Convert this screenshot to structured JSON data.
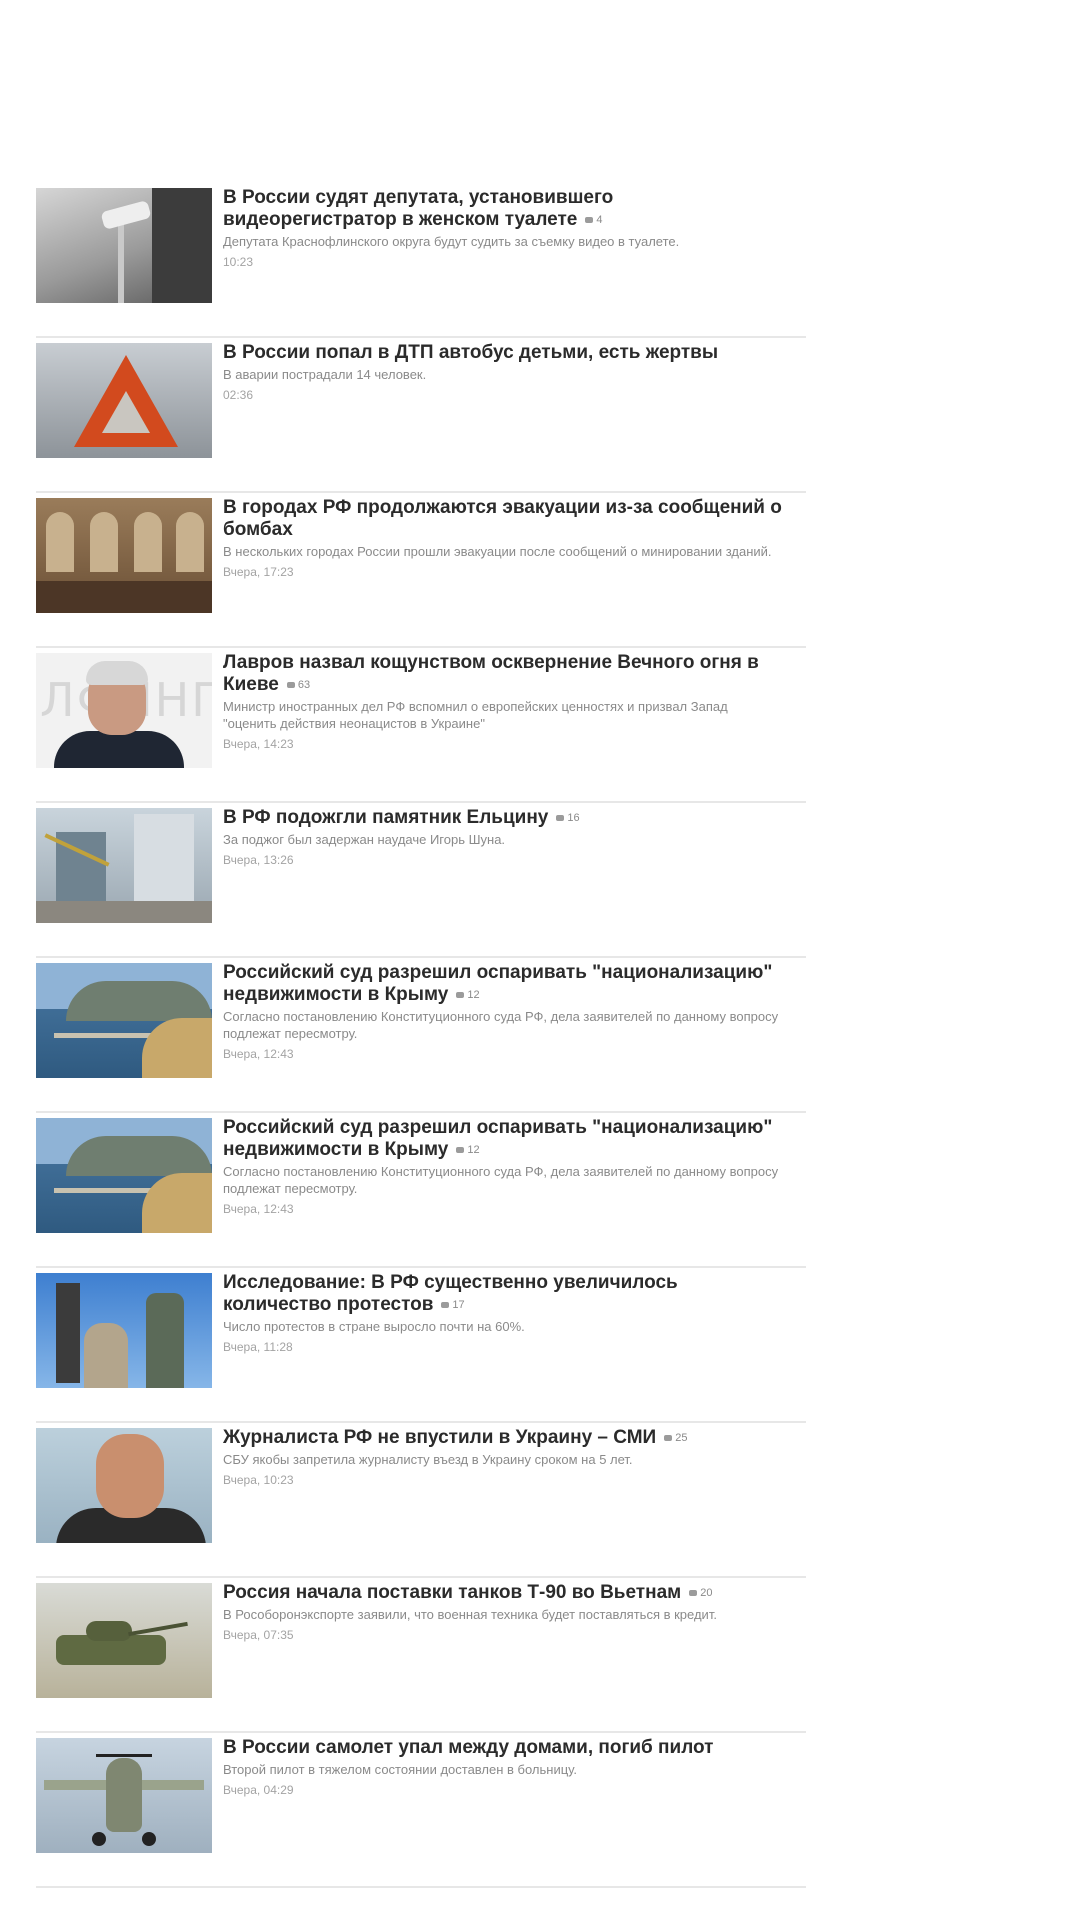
{
  "news": [
    {
      "title": "В России судят депутата, установившего видеорегистратор в женском туалете",
      "comments": "4",
      "desc": "Депутата Краснофлинского округа будут судить за съемку видео в туалете.",
      "time": "10:23",
      "image": "camera-thumbnail"
    },
    {
      "title": "В России попал в ДТП автобус детьми, есть жертвы",
      "comments": "",
      "desc": "В аварии пострадали 14 человек.",
      "time": "02:36",
      "image": "warning-triangle-thumbnail"
    },
    {
      "title": "В городах РФ продолжаются эвакуации из-за сообщений о бомбах",
      "comments": "",
      "desc": "В нескольких городах России прошли эвакуации после сообщений о минировании зданий.",
      "time": "Вчера, 17:23",
      "image": "evacuation-thumbnail"
    },
    {
      "title": "Лавров назвал кощунством осквернение Вечного огня в Киеве",
      "comments": "63",
      "desc": "Министр иностранных дел РФ вспомнил о европейских ценностях и призвал Запад \"оценить действия неонацистов в Украине\"",
      "time": "Вчера, 14:23",
      "image": "minister-portrait-thumbnail"
    },
    {
      "title": "В РФ подожгли памятник Ельцину",
      "comments": "16",
      "desc": "За поджог был задержан наудаче Игорь Шуна.",
      "time": "Вчера, 13:26",
      "image": "monument-thumbnail"
    },
    {
      "title": "Российский суд разрешил оспаривать \"национализацию\" недвижимости в Крыму",
      "comments": "12",
      "desc": "Согласно постановлению Конституционного суда РФ, дела заявителей по данному вопросу подлежат пересмотру.",
      "time": "Вчера, 12:43",
      "image": "crimea-coast-thumbnail"
    },
    {
      "title": "Российский суд разрешил оспаривать \"национализацию\" недвижимости в Крыму",
      "comments": "12",
      "desc": "Согласно постановлению Конституционного суда РФ, дела заявителей по данному вопросу подлежат пересмотру.",
      "time": "Вчера, 12:43",
      "image": "crimea-coast-thumbnail"
    },
    {
      "title": "Исследование: В РФ существенно увеличилось количество протестов",
      "comments": "17",
      "desc": "Число протестов в стране выросло почти на 60%.",
      "time": "Вчера, 11:28",
      "image": "protest-thumbnail"
    },
    {
      "title": "Журналиста РФ не впустили в Украину – СМИ",
      "comments": "25",
      "desc": "СБУ якобы запретила журналисту въезд в Украину сроком на 5 лет.",
      "time": "Вчера, 10:23",
      "image": "journalist-portrait-thumbnail"
    },
    {
      "title": "Россия начала поставки танков Т-90 во Вьетнам",
      "comments": "20",
      "desc": "В Рособоронэкспорте заявили, что военная техника будет поставляться в кредит.",
      "time": "Вчера, 07:35",
      "image": "tank-thumbnail"
    },
    {
      "title": "В России самолет упал между домами, погиб пилот",
      "comments": "",
      "desc": "Второй пилот в тяжелом состоянии доставлен в больницу.",
      "time": "Вчера, 04:29",
      "image": "plane-thumbnail"
    }
  ]
}
